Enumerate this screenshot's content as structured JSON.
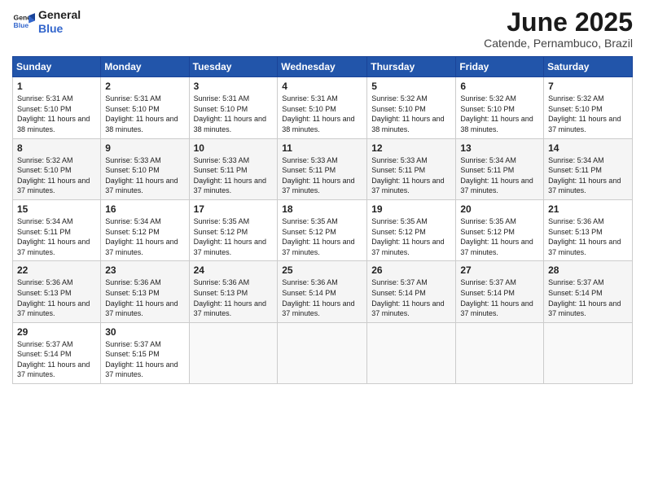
{
  "logo": {
    "line1": "General",
    "line2": "Blue"
  },
  "title": "June 2025",
  "subtitle": "Catende, Pernambuco, Brazil",
  "days_header": [
    "Sunday",
    "Monday",
    "Tuesday",
    "Wednesday",
    "Thursday",
    "Friday",
    "Saturday"
  ],
  "weeks": [
    [
      {
        "day": "1",
        "sunrise": "5:31 AM",
        "sunset": "5:10 PM",
        "daylight": "11 hours and 38 minutes."
      },
      {
        "day": "2",
        "sunrise": "5:31 AM",
        "sunset": "5:10 PM",
        "daylight": "11 hours and 38 minutes."
      },
      {
        "day": "3",
        "sunrise": "5:31 AM",
        "sunset": "5:10 PM",
        "daylight": "11 hours and 38 minutes."
      },
      {
        "day": "4",
        "sunrise": "5:31 AM",
        "sunset": "5:10 PM",
        "daylight": "11 hours and 38 minutes."
      },
      {
        "day": "5",
        "sunrise": "5:32 AM",
        "sunset": "5:10 PM",
        "daylight": "11 hours and 38 minutes."
      },
      {
        "day": "6",
        "sunrise": "5:32 AM",
        "sunset": "5:10 PM",
        "daylight": "11 hours and 38 minutes."
      },
      {
        "day": "7",
        "sunrise": "5:32 AM",
        "sunset": "5:10 PM",
        "daylight": "11 hours and 37 minutes."
      }
    ],
    [
      {
        "day": "8",
        "sunrise": "5:32 AM",
        "sunset": "5:10 PM",
        "daylight": "11 hours and 37 minutes."
      },
      {
        "day": "9",
        "sunrise": "5:33 AM",
        "sunset": "5:10 PM",
        "daylight": "11 hours and 37 minutes."
      },
      {
        "day": "10",
        "sunrise": "5:33 AM",
        "sunset": "5:11 PM",
        "daylight": "11 hours and 37 minutes."
      },
      {
        "day": "11",
        "sunrise": "5:33 AM",
        "sunset": "5:11 PM",
        "daylight": "11 hours and 37 minutes."
      },
      {
        "day": "12",
        "sunrise": "5:33 AM",
        "sunset": "5:11 PM",
        "daylight": "11 hours and 37 minutes."
      },
      {
        "day": "13",
        "sunrise": "5:34 AM",
        "sunset": "5:11 PM",
        "daylight": "11 hours and 37 minutes."
      },
      {
        "day": "14",
        "sunrise": "5:34 AM",
        "sunset": "5:11 PM",
        "daylight": "11 hours and 37 minutes."
      }
    ],
    [
      {
        "day": "15",
        "sunrise": "5:34 AM",
        "sunset": "5:11 PM",
        "daylight": "11 hours and 37 minutes."
      },
      {
        "day": "16",
        "sunrise": "5:34 AM",
        "sunset": "5:12 PM",
        "daylight": "11 hours and 37 minutes."
      },
      {
        "day": "17",
        "sunrise": "5:35 AM",
        "sunset": "5:12 PM",
        "daylight": "11 hours and 37 minutes."
      },
      {
        "day": "18",
        "sunrise": "5:35 AM",
        "sunset": "5:12 PM",
        "daylight": "11 hours and 37 minutes."
      },
      {
        "day": "19",
        "sunrise": "5:35 AM",
        "sunset": "5:12 PM",
        "daylight": "11 hours and 37 minutes."
      },
      {
        "day": "20",
        "sunrise": "5:35 AM",
        "sunset": "5:12 PM",
        "daylight": "11 hours and 37 minutes."
      },
      {
        "day": "21",
        "sunrise": "5:36 AM",
        "sunset": "5:13 PM",
        "daylight": "11 hours and 37 minutes."
      }
    ],
    [
      {
        "day": "22",
        "sunrise": "5:36 AM",
        "sunset": "5:13 PM",
        "daylight": "11 hours and 37 minutes."
      },
      {
        "day": "23",
        "sunrise": "5:36 AM",
        "sunset": "5:13 PM",
        "daylight": "11 hours and 37 minutes."
      },
      {
        "day": "24",
        "sunrise": "5:36 AM",
        "sunset": "5:13 PM",
        "daylight": "11 hours and 37 minutes."
      },
      {
        "day": "25",
        "sunrise": "5:36 AM",
        "sunset": "5:14 PM",
        "daylight": "11 hours and 37 minutes."
      },
      {
        "day": "26",
        "sunrise": "5:37 AM",
        "sunset": "5:14 PM",
        "daylight": "11 hours and 37 minutes."
      },
      {
        "day": "27",
        "sunrise": "5:37 AM",
        "sunset": "5:14 PM",
        "daylight": "11 hours and 37 minutes."
      },
      {
        "day": "28",
        "sunrise": "5:37 AM",
        "sunset": "5:14 PM",
        "daylight": "11 hours and 37 minutes."
      }
    ],
    [
      {
        "day": "29",
        "sunrise": "5:37 AM",
        "sunset": "5:14 PM",
        "daylight": "11 hours and 37 minutes."
      },
      {
        "day": "30",
        "sunrise": "5:37 AM",
        "sunset": "5:15 PM",
        "daylight": "11 hours and 37 minutes."
      },
      null,
      null,
      null,
      null,
      null
    ]
  ],
  "labels": {
    "sunrise": "Sunrise:",
    "sunset": "Sunset:",
    "daylight": "Daylight:"
  }
}
